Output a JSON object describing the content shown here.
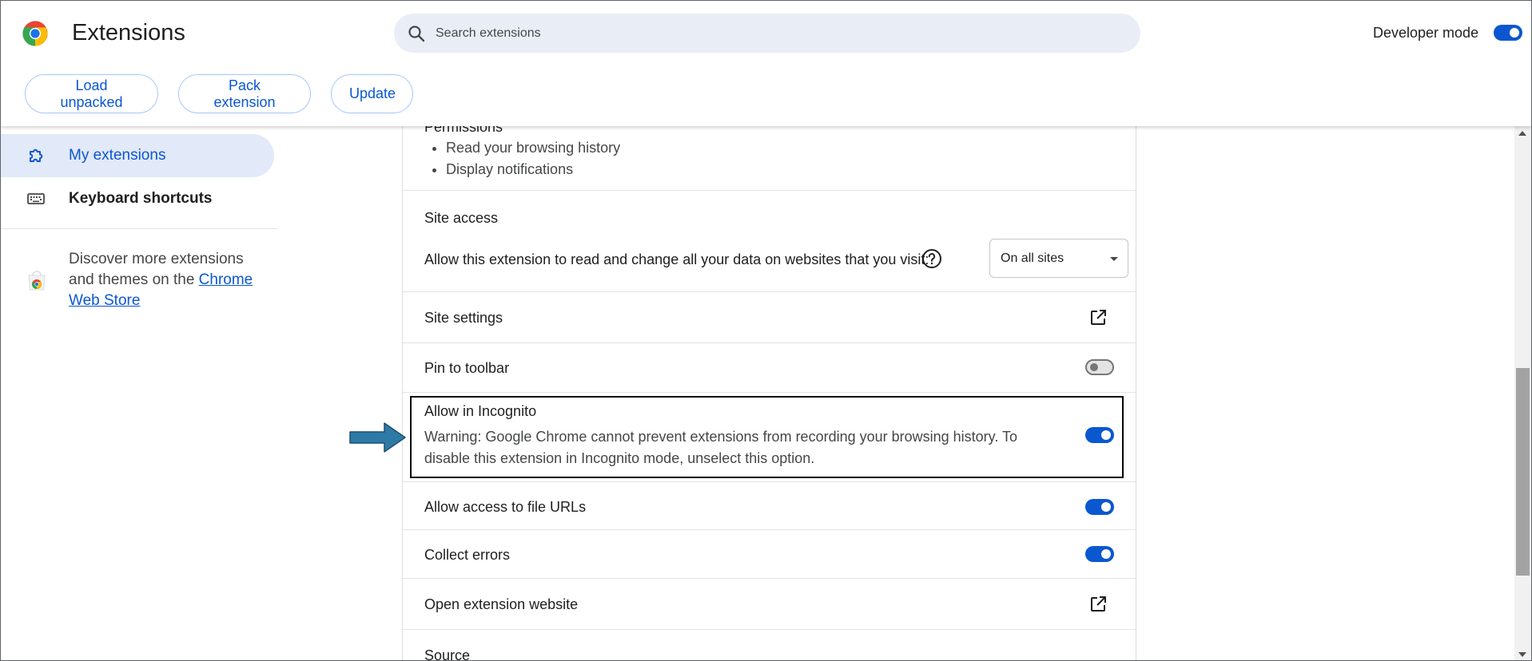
{
  "header": {
    "title": "Extensions",
    "search_placeholder": "Search extensions",
    "developer_mode_label": "Developer mode",
    "developer_mode_on": true,
    "buttons": {
      "load_unpacked": "Load unpacked",
      "pack_extension": "Pack extension",
      "update": "Update"
    }
  },
  "sidebar": {
    "items": [
      {
        "label": "My extensions",
        "icon": "puzzle-piece-icon",
        "active": true
      },
      {
        "label": "Keyboard shortcuts",
        "icon": "keyboard-icon",
        "active": false
      }
    ],
    "discover_text": "Discover more extensions and themes on the ",
    "store_link": "Chrome Web Store"
  },
  "details": {
    "permissions_heading": "Permissions",
    "permissions": [
      "Read your browsing history",
      "Display notifications"
    ],
    "site_access": {
      "heading": "Site access",
      "description": "Allow this extension to read and change all your data on websites that you visit:",
      "selected": "On all sites"
    },
    "site_settings": "Site settings",
    "pin_to_toolbar": {
      "label": "Pin to toolbar",
      "on": false
    },
    "allow_incognito": {
      "label": "Allow in Incognito",
      "warning": "Warning: Google Chrome cannot prevent extensions from recording your browsing history. To disable this extension in Incognito mode, unselect this option.",
      "on": true
    },
    "allow_file_urls": {
      "label": "Allow access to file URLs",
      "on": true
    },
    "collect_errors": {
      "label": "Collect errors",
      "on": true
    },
    "open_website": "Open extension website",
    "source_heading": "Source"
  },
  "colors": {
    "accent": "#0b57d0",
    "active_nav_bg": "#e2e9f8",
    "search_bg": "#e9eef6",
    "arrow": "#2e7aa6"
  }
}
